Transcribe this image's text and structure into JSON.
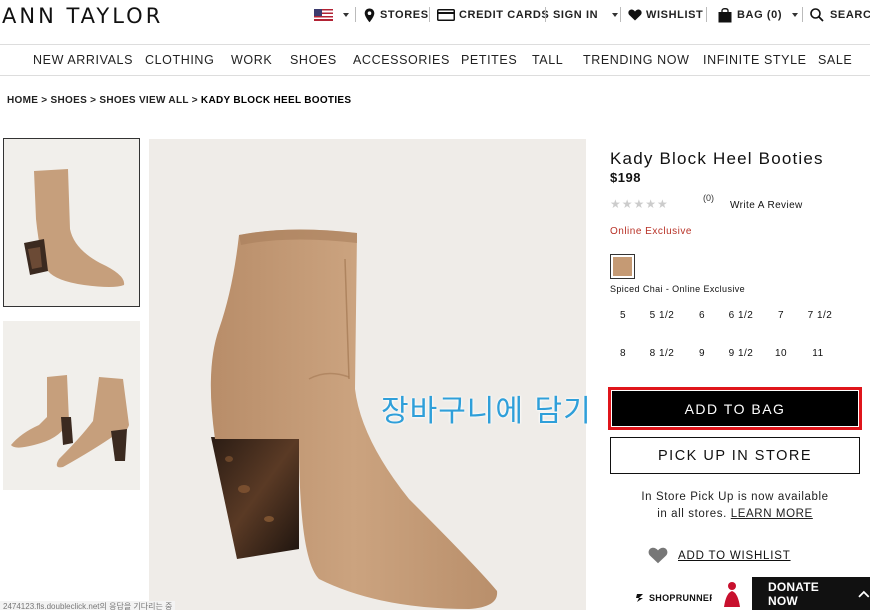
{
  "brand": {
    "logo": "ANN TAYLOR"
  },
  "utility": {
    "stores": "STORES",
    "credit_cards": "CREDIT CARDS",
    "sign_in": "SIGN IN",
    "wishlist": "WISHLIST",
    "bag": "BAG (0)",
    "search": "SEARCH"
  },
  "nav": {
    "items": [
      "NEW ARRIVALS",
      "CLOTHING",
      "WORK",
      "SHOES",
      "ACCESSORIES",
      "PETITES",
      "TALL",
      "TRENDING NOW",
      "INFINITE STYLE",
      "SALE"
    ]
  },
  "breadcrumb": {
    "home": "HOME",
    "shoes": "SHOES",
    "shoes_view_all": "SHOES VIEW ALL",
    "current": "KADY BLOCK HEEL BOOTIES",
    "sep": ">"
  },
  "product": {
    "title": "Kady Block Heel Booties",
    "price": "$198",
    "stars": "★★★★★",
    "rating": 0,
    "review_count": "(0)",
    "write_review": "Write A Review",
    "badge": "Online Exclusive",
    "swatch_color": "#c59a74",
    "color_name": "Spiced Chai - Online Exclusive",
    "sizes_row1": [
      "5",
      "5 1/2",
      "6",
      "6 1/2",
      "7",
      "7 1/2"
    ],
    "sizes_row2": [
      "8",
      "8 1/2",
      "9",
      "9 1/2",
      "10",
      "11"
    ],
    "add_to_bag": "ADD TO BAG",
    "pick_up": "PICK UP IN STORE",
    "pickup_line1": "In Store Pick Up is now available",
    "pickup_line2": "in all stores.",
    "learn_more": "LEARN MORE",
    "add_to_wishlist": "ADD TO WISHLIST",
    "shoprunner": "SHOPRUNNER"
  },
  "overlay": {
    "korean_label": "장바구니에 담기"
  },
  "donate": {
    "label": "DONATE NOW"
  },
  "status": {
    "text": "2474123.fls.doubleclick.net의 응답을 기다리는 중"
  },
  "colors": {
    "highlight": "#e0151b",
    "exclusive": "#b83227",
    "overlay": "#2f9fd9"
  }
}
